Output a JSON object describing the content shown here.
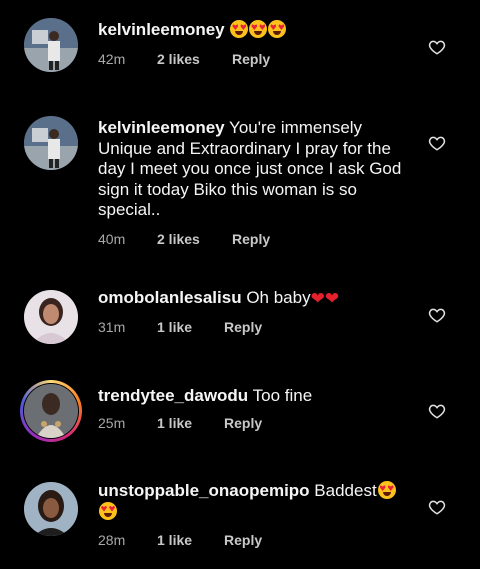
{
  "comments": [
    {
      "username": "kelvinleemoney",
      "text": "",
      "emojis_after": 3,
      "time": "42m",
      "likes": "2 likes",
      "reply": "Reply"
    },
    {
      "username": "kelvinleemoney",
      "text": "You're immensely Unique and Extraordinary I pray for the day I meet you once just once I ask God sign it today Biko this woman is so special..",
      "time": "40m",
      "likes": "2 likes",
      "reply": "Reply"
    },
    {
      "username": "omobolanlesalisu",
      "text": "Oh baby",
      "hearts_after": 2,
      "time": "31m",
      "likes": "1 like",
      "reply": "Reply"
    },
    {
      "username": "trendytee_dawodu",
      "text": "Too fine",
      "time": "25m",
      "likes": "1 like",
      "reply": "Reply"
    },
    {
      "username": "unstoppable_onaopemipo",
      "text": "Baddest",
      "emojis_after": 2,
      "time": "28m",
      "likes": "1 like",
      "reply": "Reply"
    }
  ],
  "icons": {
    "like": "heart-outline-icon",
    "emoji_love": "heart-eyes-emoji",
    "emoji_red_heart": "red-heart-emoji"
  },
  "colors": {
    "background": "#000000",
    "text": "#f5f5f5",
    "meta": "#a8a8a8",
    "story_ring": "#d62976"
  }
}
